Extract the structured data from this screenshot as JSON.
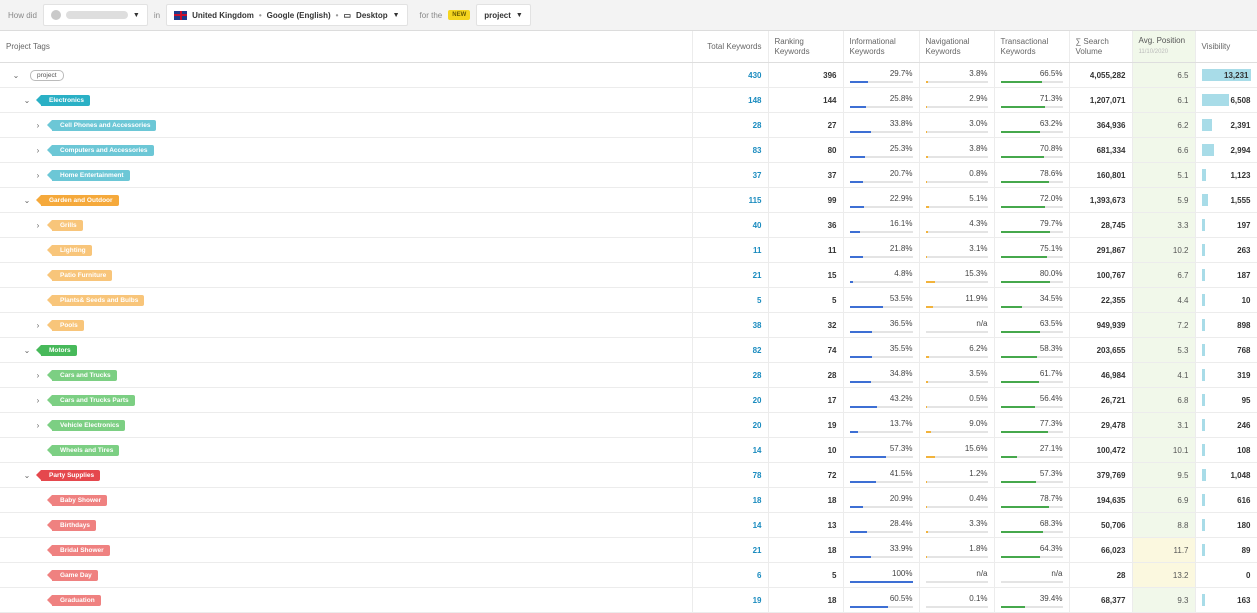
{
  "topbar": {
    "how_did": "How did",
    "in": "in",
    "location": "United Kingdom",
    "engine": "Google (English)",
    "device": "Desktop",
    "for_the": "for the",
    "new_badge": "NEW",
    "project": "project"
  },
  "columns": {
    "tags": "Project Tags",
    "total": "Total Keywords",
    "ranking": [
      "Ranking",
      "Keywords"
    ],
    "informational": [
      "Informational",
      "Keywords"
    ],
    "navigational": [
      "Navigational",
      "Keywords"
    ],
    "transactional": [
      "Transactional",
      "Keywords"
    ],
    "search_volume": [
      "∑ Search",
      "Volume"
    ],
    "avg_position": "Avg. Position",
    "avg_position_date": "11/10/2020",
    "visibility": "Visibility"
  },
  "colors": {
    "root": "#ffffff",
    "electronics": "#2ab0c5",
    "electronics_light": "#6cc7d6",
    "garden": "#f5a93b",
    "garden_light": "#f8c57a",
    "motors": "#47b95a",
    "motors_light": "#7ccf83",
    "party": "#e5484d",
    "party_light": "#ef8180",
    "info_bar": "#3d6fd4",
    "nav_bar": "#f2b33b",
    "trans_bar": "#46a84c"
  },
  "rows": [
    {
      "name": "project",
      "level": 0,
      "chevron": "v",
      "color": "root",
      "total": "430",
      "ranking": "396",
      "info": "29.7%",
      "info_v": 29.7,
      "nav": "3.8%",
      "nav_v": 3.8,
      "trans": "66.5%",
      "trans_v": 66.5,
      "sv": "4,055,282",
      "pos": "6.5",
      "vis": "13,231",
      "vis_v": 100
    },
    {
      "name": "Electronics",
      "level": 1,
      "chevron": "v",
      "color": "electronics",
      "total": "148",
      "ranking": "144",
      "info": "25.8%",
      "info_v": 25.8,
      "nav": "2.9%",
      "nav_v": 2.9,
      "trans": "71.3%",
      "trans_v": 71.3,
      "sv": "1,207,071",
      "pos": "6.1",
      "vis": "6,508",
      "vis_v": 49
    },
    {
      "name": "Cell Phones and Accessories",
      "level": 2,
      "chevron": ">",
      "color": "electronics_light",
      "total": "28",
      "ranking": "27",
      "info": "33.8%",
      "info_v": 33.8,
      "nav": "3.0%",
      "nav_v": 3.0,
      "trans": "63.2%",
      "trans_v": 63.2,
      "sv": "364,936",
      "pos": "6.2",
      "vis": "2,391",
      "vis_v": 18
    },
    {
      "name": "Computers and Accessories",
      "level": 2,
      "chevron": ">",
      "color": "electronics_light",
      "total": "83",
      "ranking": "80",
      "info": "25.3%",
      "info_v": 25.3,
      "nav": "3.8%",
      "nav_v": 3.8,
      "trans": "70.8%",
      "trans_v": 70.8,
      "sv": "681,334",
      "pos": "6.6",
      "vis": "2,994",
      "vis_v": 23
    },
    {
      "name": "Home Entertainment",
      "level": 2,
      "chevron": ">",
      "color": "electronics_light",
      "total": "37",
      "ranking": "37",
      "info": "20.7%",
      "info_v": 20.7,
      "nav": "0.8%",
      "nav_v": 0.8,
      "trans": "78.6%",
      "trans_v": 78.6,
      "sv": "160,801",
      "pos": "5.1",
      "vis": "1,123",
      "vis_v": 8.5
    },
    {
      "name": "Garden and Outdoor",
      "level": 1,
      "chevron": "v",
      "color": "garden",
      "total": "115",
      "ranking": "99",
      "info": "22.9%",
      "info_v": 22.9,
      "nav": "5.1%",
      "nav_v": 5.1,
      "trans": "72.0%",
      "trans_v": 72.0,
      "sv": "1,393,673",
      "pos": "5.9",
      "vis": "1,555",
      "vis_v": 12
    },
    {
      "name": "Grills",
      "level": 2,
      "chevron": ">",
      "color": "garden_light",
      "total": "40",
      "ranking": "36",
      "info": "16.1%",
      "info_v": 16.1,
      "nav": "4.3%",
      "nav_v": 4.3,
      "trans": "79.7%",
      "trans_v": 79.7,
      "sv": "28,745",
      "pos": "3.3",
      "vis": "197",
      "vis_v": 1.5
    },
    {
      "name": "Lighting",
      "level": 2,
      "chevron": "",
      "color": "garden_light",
      "total": "11",
      "ranking": "11",
      "info": "21.8%",
      "info_v": 21.8,
      "nav": "3.1%",
      "nav_v": 3.1,
      "trans": "75.1%",
      "trans_v": 75.1,
      "sv": "291,867",
      "pos": "10.2",
      "vis": "263",
      "vis_v": 2
    },
    {
      "name": "Patio Furniture",
      "level": 2,
      "chevron": "",
      "color": "garden_light",
      "total": "21",
      "ranking": "15",
      "info": "4.8%",
      "info_v": 4.8,
      "nav": "15.3%",
      "nav_v": 15.3,
      "trans": "80.0%",
      "trans_v": 80.0,
      "sv": "100,767",
      "pos": "6.7",
      "vis": "187",
      "vis_v": 1.4
    },
    {
      "name": "Plants& Seeds and Bulbs",
      "level": 2,
      "chevron": "",
      "color": "garden_light",
      "total": "5",
      "ranking": "5",
      "info": "53.5%",
      "info_v": 53.5,
      "nav": "11.9%",
      "nav_v": 11.9,
      "trans": "34.5%",
      "trans_v": 34.5,
      "sv": "22,355",
      "pos": "4.4",
      "vis": "10",
      "vis_v": 0.3
    },
    {
      "name": "Pools",
      "level": 2,
      "chevron": ">",
      "color": "garden_light",
      "total": "38",
      "ranking": "32",
      "info": "36.5%",
      "info_v": 36.5,
      "nav": "n/a",
      "nav_v": 0,
      "trans": "63.5%",
      "trans_v": 63.5,
      "sv": "949,939",
      "pos": "7.2",
      "vis": "898",
      "vis_v": 6.8
    },
    {
      "name": "Motors",
      "level": 1,
      "chevron": "v",
      "color": "motors",
      "total": "82",
      "ranking": "74",
      "info": "35.5%",
      "info_v": 35.5,
      "nav": "6.2%",
      "nav_v": 6.2,
      "trans": "58.3%",
      "trans_v": 58.3,
      "sv": "203,655",
      "pos": "5.3",
      "vis": "768",
      "vis_v": 5.8
    },
    {
      "name": "Cars and Trucks",
      "level": 2,
      "chevron": ">",
      "color": "motors_light",
      "total": "28",
      "ranking": "28",
      "info": "34.8%",
      "info_v": 34.8,
      "nav": "3.5%",
      "nav_v": 3.5,
      "trans": "61.7%",
      "trans_v": 61.7,
      "sv": "46,984",
      "pos": "4.1",
      "vis": "319",
      "vis_v": 2.4
    },
    {
      "name": "Cars and Trucks Parts",
      "level": 2,
      "chevron": ">",
      "color": "motors_light",
      "total": "20",
      "ranking": "17",
      "info": "43.2%",
      "info_v": 43.2,
      "nav": "0.5%",
      "nav_v": 0.5,
      "trans": "56.4%",
      "trans_v": 56.4,
      "sv": "26,721",
      "pos": "6.8",
      "vis": "95",
      "vis_v": 0.7
    },
    {
      "name": "Vehicle Electronics",
      "level": 2,
      "chevron": ">",
      "color": "motors_light",
      "total": "20",
      "ranking": "19",
      "info": "13.7%",
      "info_v": 13.7,
      "nav": "9.0%",
      "nav_v": 9.0,
      "trans": "77.3%",
      "trans_v": 77.3,
      "sv": "29,478",
      "pos": "3.1",
      "vis": "246",
      "vis_v": 1.9
    },
    {
      "name": "Wheels and Tires",
      "level": 2,
      "chevron": "",
      "color": "motors_light",
      "total": "14",
      "ranking": "10",
      "info": "57.3%",
      "info_v": 57.3,
      "nav": "15.6%",
      "nav_v": 15.6,
      "trans": "27.1%",
      "trans_v": 27.1,
      "sv": "100,472",
      "pos": "10.1",
      "vis": "108",
      "vis_v": 0.8
    },
    {
      "name": "Party Supplies",
      "level": 1,
      "chevron": "v",
      "color": "party",
      "total": "78",
      "ranking": "72",
      "info": "41.5%",
      "info_v": 41.5,
      "nav": "1.2%",
      "nav_v": 1.2,
      "trans": "57.3%",
      "trans_v": 57.3,
      "sv": "379,769",
      "pos": "9.5",
      "vis": "1,048",
      "vis_v": 7.9
    },
    {
      "name": "Baby Shower",
      "level": 2,
      "chevron": "",
      "color": "party_light",
      "total": "18",
      "ranking": "18",
      "info": "20.9%",
      "info_v": 20.9,
      "nav": "0.4%",
      "nav_v": 0.4,
      "trans": "78.7%",
      "trans_v": 78.7,
      "sv": "194,635",
      "pos": "6.9",
      "vis": "616",
      "vis_v": 4.7
    },
    {
      "name": "Birthdays",
      "level": 2,
      "chevron": "",
      "color": "party_light",
      "total": "14",
      "ranking": "13",
      "info": "28.4%",
      "info_v": 28.4,
      "nav": "3.3%",
      "nav_v": 3.3,
      "trans": "68.3%",
      "trans_v": 68.3,
      "sv": "50,706",
      "pos": "8.8",
      "vis": "180",
      "vis_v": 1.4
    },
    {
      "name": "Bridal Shower",
      "level": 2,
      "chevron": "",
      "color": "party_light",
      "total": "21",
      "ranking": "18",
      "info": "33.9%",
      "info_v": 33.9,
      "nav": "1.8%",
      "nav_v": 1.8,
      "trans": "64.3%",
      "trans_v": 64.3,
      "sv": "66,023",
      "pos": "11.7",
      "vis": "89",
      "vis_v": 0.7,
      "warn": true
    },
    {
      "name": "Game Day",
      "level": 2,
      "chevron": "",
      "color": "party_light",
      "total": "6",
      "ranking": "5",
      "info": "100%",
      "info_v": 100,
      "nav": "n/a",
      "nav_v": 0,
      "trans": "n/a",
      "trans_v": 0,
      "sv": "28",
      "pos": "13.2",
      "vis": "0",
      "vis_v": 0,
      "warn": true
    },
    {
      "name": "Graduation",
      "level": 2,
      "chevron": "",
      "color": "party_light",
      "total": "19",
      "ranking": "18",
      "info": "60.5%",
      "info_v": 60.5,
      "nav": "0.1%",
      "nav_v": 0.1,
      "trans": "39.4%",
      "trans_v": 39.4,
      "sv": "68,377",
      "pos": "9.3",
      "vis": "163",
      "vis_v": 1.2
    }
  ]
}
